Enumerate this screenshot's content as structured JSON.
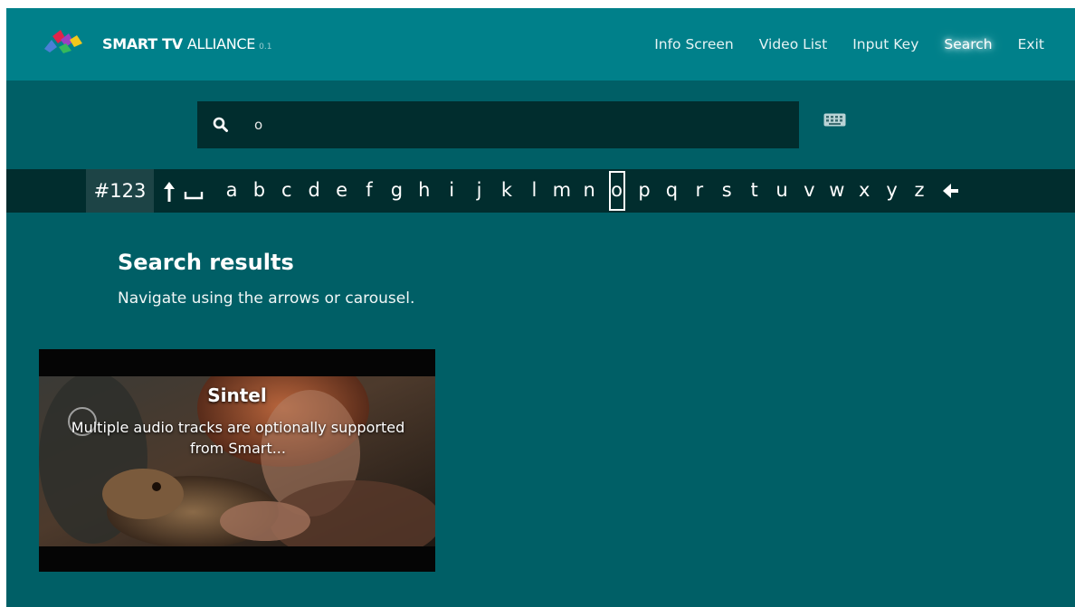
{
  "header": {
    "brand_bold": "SMART TV",
    "brand_light": "ALLIANCE",
    "brand_version": "0.1",
    "nav": [
      "Info Screen",
      "Video List",
      "Input Key",
      "Search",
      "Exit"
    ],
    "active_nav": "Search"
  },
  "search": {
    "value": "o",
    "icon": "search-icon"
  },
  "keyboard": {
    "numeric_key": "#123",
    "shift_icon": "arrow-up-icon",
    "space_icon": "space-icon",
    "letters": [
      "a",
      "b",
      "c",
      "d",
      "e",
      "f",
      "g",
      "h",
      "i",
      "j",
      "k",
      "l",
      "m",
      "n",
      "o",
      "p",
      "q",
      "r",
      "s",
      "t",
      "u",
      "v",
      "w",
      "x",
      "y",
      "z"
    ],
    "selected_letter": "o",
    "backspace_icon": "arrow-left-icon"
  },
  "results": {
    "title": "Search results",
    "subtitle": "Navigate using the arrows or carousel.",
    "items": [
      {
        "title": "Sintel",
        "description": "Multiple audio tracks are optionally supported from Smart..."
      }
    ]
  },
  "colors": {
    "header_bg": "#00808a",
    "body_bg": "#005f66",
    "bar_bg": "#012d2e"
  }
}
